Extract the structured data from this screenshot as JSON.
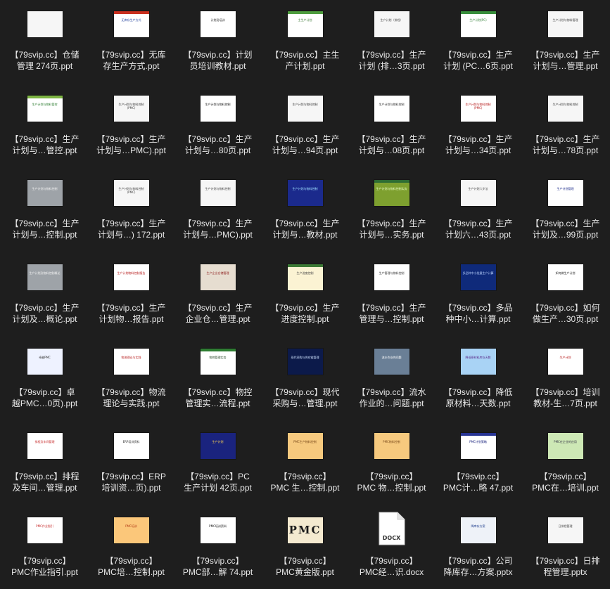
{
  "files": [
    {
      "name": "【79svip.cc】仓储\n管理 274页.ppt",
      "theme": "white",
      "thumb_text": ""
    },
    {
      "name": "【79svip.cc】无库\n存生产方式.ppt",
      "theme": "blue-list",
      "thumb_text": "无库存生产方式"
    },
    {
      "name": "【79svip.cc】计划\n员培训教材.ppt",
      "theme": "text-dense",
      "thumb_text": "计划员培训"
    },
    {
      "name": "【79svip.cc】主生\n产计划.ppt",
      "theme": "green-banner",
      "thumb_text": "主生产计划"
    },
    {
      "name": "【79svip.cc】生产\n计划 (排…3页.ppt",
      "theme": "white",
      "thumb_text": "生产计划（排程）"
    },
    {
      "name": "【79svip.cc】生产\n计划 (PC…6页.ppt",
      "theme": "green-list",
      "thumb_text": "生产计划(PC)"
    },
    {
      "name": "【79svip.cc】生产\n计划与…管理.ppt",
      "theme": "white",
      "thumb_text": "生产计划与物料管理"
    },
    {
      "name": "【79svip.cc】生产\n计划与…管控.ppt",
      "theme": "green-line",
      "thumb_text": "生产计划与物料管控"
    },
    {
      "name": "【79svip.cc】生产\n计划与…PMC).ppt",
      "theme": "white",
      "thumb_text": "生产计划与物料控制(PMC)"
    },
    {
      "name": "【79svip.cc】生产\n计划与…80页.ppt",
      "theme": "text-dense",
      "thumb_text": "生产计划与物料控制"
    },
    {
      "name": "【79svip.cc】生产\n计划与…94页.ppt",
      "theme": "white",
      "thumb_text": "生产计划与物料控制"
    },
    {
      "name": "【79svip.cc】生产\n计划与…08页.ppt",
      "theme": "white-figure",
      "thumb_text": "生产计划与物料控制"
    },
    {
      "name": "【79svip.cc】生产\n计划与…34页.ppt",
      "theme": "white-red",
      "thumb_text": "生产计划与物料控制(PMC)"
    },
    {
      "name": "【79svip.cc】生产\n计划与…78页.ppt",
      "theme": "white",
      "thumb_text": "生产计划与物料控制"
    },
    {
      "name": "【79svip.cc】生产\n计划与…控制.ppt",
      "theme": "gray",
      "thumb_text": "生产计划与物料控制"
    },
    {
      "name": "【79svip.cc】生产\n计划与…) 172.ppt",
      "theme": "white",
      "thumb_text": "生产计划与物料控制(PMC)"
    },
    {
      "name": "【79svip.cc】生产\n计划与…PMC).ppt",
      "theme": "white",
      "thumb_text": "生产计划与物料控制"
    },
    {
      "name": "【79svip.cc】生产\n计划与…教材.ppt",
      "theme": "navy",
      "thumb_text": "生产计划与物料控制"
    },
    {
      "name": "【79svip.cc】生产\n计划与…实务.ppt",
      "theme": "olive",
      "thumb_text": "生产计划与物料控制实务"
    },
    {
      "name": "【79svip.cc】生产\n计划六…43页.ppt",
      "theme": "white",
      "thumb_text": "生产计划六步法"
    },
    {
      "name": "【79svip.cc】生产\n计划及…99页.ppt",
      "theme": "white-blue",
      "thumb_text": "生产计划管理"
    },
    {
      "name": "【79svip.cc】生产\n计划及…概论.ppt",
      "theme": "gray",
      "thumb_text": "生产计划及物料控制概论"
    },
    {
      "name": "【79svip.cc】生产\n计划物…报告.ppt",
      "theme": "white-red",
      "thumb_text": "生产计划物料控制报告"
    },
    {
      "name": "【79svip.cc】生产\n企业仓…管理.ppt",
      "theme": "photo-strip",
      "thumb_text": "生产企业仓储管理"
    },
    {
      "name": "【79svip.cc】生产\n进度控制.ppt",
      "theme": "cream",
      "thumb_text": "生产进度控制"
    },
    {
      "name": "【79svip.cc】生产\n管理与…控制.ppt",
      "theme": "white-figure",
      "thumb_text": "生产管理与物料控制"
    },
    {
      "name": "【79svip.cc】多品\n种中小…计算.ppt",
      "theme": "navy-text",
      "thumb_text": "多品种中小批量生产计算"
    },
    {
      "name": "【79svip.cc】如何\n做生产…30页.ppt",
      "theme": "white-logo",
      "thumb_text": "如何做生产计划"
    },
    {
      "name": "【79svip.cc】卓\n越PMC…0页).ppt",
      "theme": "cards",
      "thumb_text": "卓越PMC"
    },
    {
      "name": "【79svip.cc】物流\n理论与实践.ppt",
      "theme": "white-red",
      "thumb_text": "物流理论与实践"
    },
    {
      "name": "【79svip.cc】物控\n管理实…流程.ppt",
      "theme": "green-box",
      "thumb_text": "物控管理实务"
    },
    {
      "name": "【79svip.cc】现代\n采购与…管理.ppt",
      "theme": "night",
      "thumb_text": "现代采购与供应链管理"
    },
    {
      "name": "【79svip.cc】流水\n作业的…问题.ppt",
      "theme": "slate",
      "thumb_text": "流水作业的问题"
    },
    {
      "name": "【79svip.cc】降低\n原材料…天数.ppt",
      "theme": "sky",
      "thumb_text": "降低原材料库存天数"
    },
    {
      "name": "【79svip.cc】培训\n教材-生…7页.ppt",
      "theme": "white-red",
      "thumb_text": "生产计划"
    },
    {
      "name": "【79svip.cc】排程\n及车间…管理.ppt",
      "theme": "framed",
      "thumb_text": "排程及车间管理"
    },
    {
      "name": "【79svip.cc】ERP\n培训资…页).ppt",
      "theme": "white-frame",
      "thumb_text": "ERP培训资料"
    },
    {
      "name": "【79svip.cc】PC\n生产计划 42页.ppt",
      "theme": "navy-list",
      "thumb_text": "生产计划"
    },
    {
      "name": "【79svip.cc】\nPMC 生…控制.ppt",
      "theme": "peach",
      "thumb_text": "PMC生产物料控制"
    },
    {
      "name": "【79svip.cc】\nPMC 物…控制.ppt",
      "theme": "peach",
      "thumb_text": "PMC物料控制"
    },
    {
      "name": "【79svip.cc】\nPMC计…略 47.ppt",
      "theme": "white-bluehead",
      "thumb_text": "PMC计划策略"
    },
    {
      "name": "【79svip.cc】\nPMC在…培训.ppt",
      "theme": "map",
      "thumb_text": "PMC在企业的应用"
    },
    {
      "name": "【79svip.cc】\nPMC作业指引.ppt",
      "theme": "diagram",
      "thumb_text": "PMC作业指引"
    },
    {
      "name": "【79svip.cc】\nPMC培…控制.ppt",
      "theme": "orange",
      "thumb_text": "PMC培训"
    },
    {
      "name": "【79svip.cc】\nPMC部…解 74.ppt",
      "theme": "white-serif",
      "thumb_text": "PMC培训资料"
    },
    {
      "name": "【79svip.cc】\nPMC黄金版.ppt",
      "theme": "pmc-gold",
      "thumb_text": "PMC"
    },
    {
      "name": "【79svip.cc】\nPMC经…识.docx",
      "theme": "docx",
      "thumb_text": "DOCX"
    },
    {
      "name": "【79svip.cc】公司\n降库存…方案.pptx",
      "theme": "table",
      "thumb_text": "降库存方案"
    },
    {
      "name": "【79svip.cc】日排\n程管理.pptx",
      "theme": "white",
      "thumb_text": "日排程管理"
    }
  ]
}
